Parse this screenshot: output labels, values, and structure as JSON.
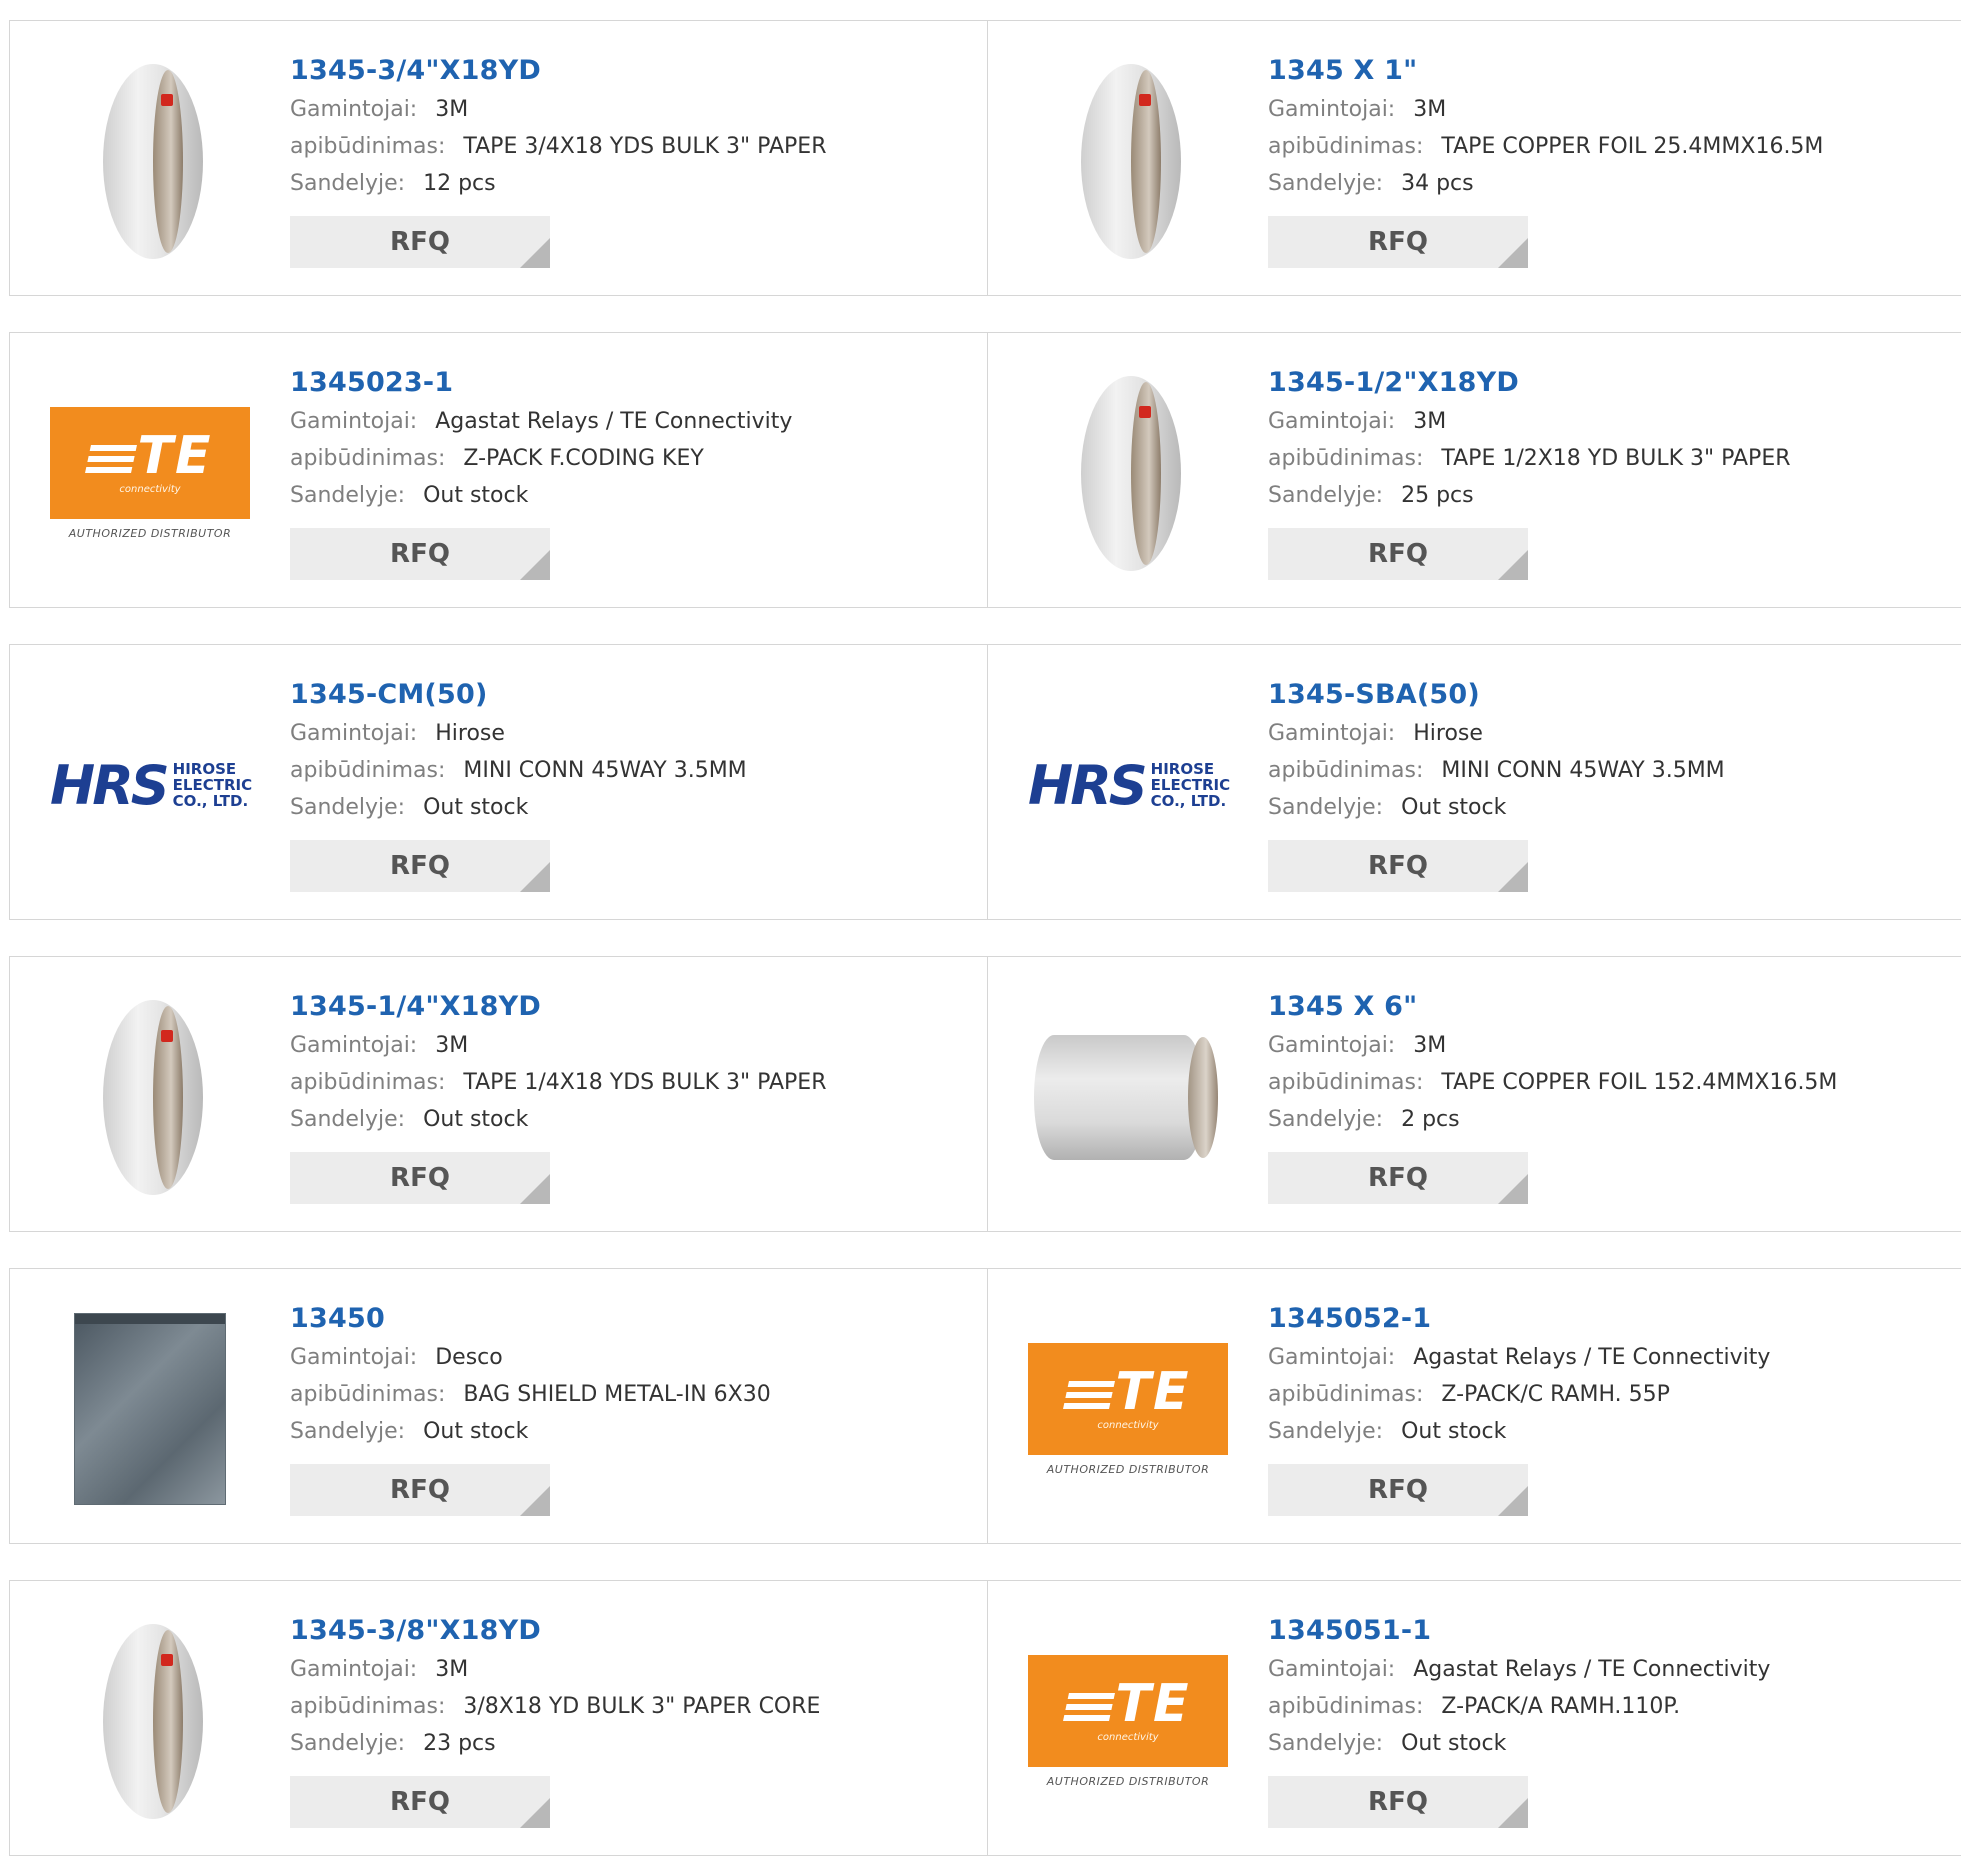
{
  "labels": {
    "manufacturer": "Gamintojai:",
    "description": "apibūdinimas:",
    "stock": "Sandelyje:"
  },
  "rfq_label": "RFQ",
  "colors": {
    "link_blue": "#1f63b0",
    "te_orange": "#f28c1e",
    "hrs_blue": "#1d3f92",
    "rfq_bg": "#ececec"
  },
  "logos": {
    "te": {
      "mark": "TE",
      "sub": "connectivity",
      "authorized": "AUTHORIZED DISTRIBUTOR"
    },
    "hrs": {
      "mark": "HRS",
      "line1": "HIROSE",
      "line2": "ELECTRIC",
      "line3": "CO., LTD."
    }
  },
  "products": [
    {
      "part": "1345-3/4\"X18YD",
      "manufacturer": "3M",
      "description": "TAPE 3/4X18 YDS BULK 3\" PAPER",
      "stock": "12 pcs",
      "image": "tape-roll-icon"
    },
    {
      "part": "1345 X 1\"",
      "manufacturer": "3M",
      "description": "TAPE COPPER FOIL 25.4MMX16.5M",
      "stock": "34 pcs",
      "image": "tape-roll-icon"
    },
    {
      "part": "1345023-1",
      "manufacturer": "Agastat Relays / TE Connectivity",
      "description": "Z-PACK F.CODING KEY",
      "stock": "Out stock",
      "image": "te-logo"
    },
    {
      "part": "1345-1/2\"X18YD",
      "manufacturer": "3M",
      "description": "TAPE 1/2X18 YD BULK 3\" PAPER",
      "stock": "25 pcs",
      "image": "tape-roll-icon"
    },
    {
      "part": "1345-CM(50)",
      "manufacturer": "Hirose",
      "description": "MINI CONN 45WAY 3.5MM",
      "stock": "Out stock",
      "image": "hrs-logo"
    },
    {
      "part": "1345-SBA(50)",
      "manufacturer": "Hirose",
      "description": "MINI CONN 45WAY 3.5MM",
      "stock": "Out stock",
      "image": "hrs-logo"
    },
    {
      "part": "1345-1/4\"X18YD",
      "manufacturer": "3M",
      "description": "TAPE 1/4X18 YDS BULK 3\" PAPER",
      "stock": "Out stock",
      "image": "tape-roll-icon"
    },
    {
      "part": "1345 X 6\"",
      "manufacturer": "3M",
      "description": "TAPE COPPER FOIL 152.4MMX16.5M",
      "stock": "2 pcs",
      "image": "wide-tape-icon"
    },
    {
      "part": "13450",
      "manufacturer": "Desco",
      "description": "BAG SHIELD METAL-IN 6X30",
      "stock": "Out stock",
      "image": "shield-bag-icon"
    },
    {
      "part": "1345052-1",
      "manufacturer": "Agastat Relays / TE Connectivity",
      "description": "Z-PACK/C RAMH. 55P",
      "stock": "Out stock",
      "image": "te-logo"
    },
    {
      "part": "1345-3/8\"X18YD",
      "manufacturer": "3M",
      "description": "3/8X18 YD BULK 3\" PAPER CORE",
      "stock": "23 pcs",
      "image": "tape-roll-icon"
    },
    {
      "part": "1345051-1",
      "manufacturer": "Agastat Relays / TE Connectivity",
      "description": "Z-PACK/A RAMH.110P.",
      "stock": "Out stock",
      "image": "te-logo"
    }
  ]
}
